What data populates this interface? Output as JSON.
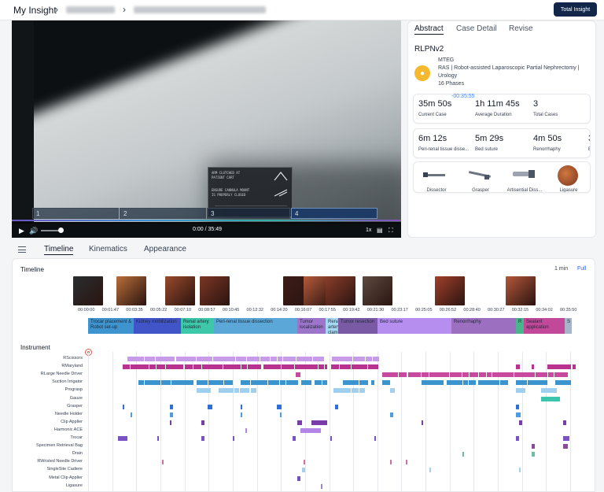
{
  "header": {
    "breadcrumb_root": "My Insight",
    "total_insight_label": "Total Insight"
  },
  "video": {
    "overlay_lines": [
      "ARM CLUTCHED AT",
      "PATIENT CART",
      "ENSURE CANNULA MOUNT",
      "IS PROPERLY CLOSED"
    ],
    "phase_markers": [
      "1",
      "2",
      "3",
      "4"
    ],
    "time": "0:00 / 35:49",
    "speed": "1x"
  },
  "panel": {
    "tabs": [
      "Abstract",
      "Case Detail",
      "Revise"
    ],
    "procedure_title": "RLPNv2",
    "meta": {
      "line1": "MTEG",
      "line2": "RAS | Robot-assisted Laparoscopic Partial Nephrectomy |",
      "line3": "Urology",
      "line4": "16 Phases"
    },
    "stats": [
      {
        "value": "35m 50s",
        "label": "Current Case",
        "overlay": "-00:35:55"
      },
      {
        "value": "1h 11m 45s",
        "label": "Average Duration"
      },
      {
        "value": "3",
        "label": "Total Cases"
      }
    ],
    "phase_stats": [
      {
        "value": "6m 12s",
        "label": "Peri-renal tissue disse..."
      },
      {
        "value": "5m 29s",
        "label": "Bed suture"
      },
      {
        "value": "4m 50s",
        "label": "Renorrhaphy"
      },
      {
        "value": "3",
        "label": "B"
      }
    ],
    "instruments": [
      {
        "label": "Dissector",
        "icon": "dissector-icon"
      },
      {
        "label": "Grasper",
        "icon": "grasper-icon"
      },
      {
        "label": "Artisential Diss...",
        "icon": "artisential-dissector-icon"
      },
      {
        "label": "Ligasure",
        "icon": "ligasure-icon"
      }
    ]
  },
  "tabs": [
    "Timeline",
    "Kinematics",
    "Appearance"
  ],
  "timeline": {
    "title": "Timeline",
    "zoom_options": [
      "1 min",
      "Full"
    ],
    "ticks": [
      "00:00:00",
      "00:01:47",
      "00:03:35",
      "00:05:22",
      "00:07:10",
      "00:08:57",
      "00:10:45",
      "00:12:32",
      "00:14:20",
      "00:16:07",
      "00:17:55",
      "00:19:42",
      "00:21:30",
      "00:23:17",
      "00:25:05",
      "00:26:52",
      "00:28:40",
      "00:30:27",
      "00:32:15",
      "00:34:02",
      "00:35:50"
    ],
    "thumb_colors": [
      "#2a2e30",
      "#b96e3a",
      "#9a4a2c",
      "#7b3624",
      "#3d1c18",
      "#b75a3a",
      "#8a3d2a",
      "#5e4a40",
      "#a0402a",
      "#b4573a"
    ],
    "phases": [
      {
        "label": "Trocar placement & Robot set-up",
        "color": "#3e94cf"
      },
      {
        "label": "Kidney mobilization",
        "color": "#4255c8"
      },
      {
        "label": "Renal artery isolation",
        "color": "#3cc8a9"
      },
      {
        "label": "Peri-renal tissue dissection",
        "color": "#5aa7d8"
      },
      {
        "label": "Tumor localization",
        "color": "#9c74c9"
      },
      {
        "label": "Renal artery clamping",
        "color": "#a7d8f2"
      },
      {
        "label": "Tumor resection",
        "color": "#7a5aa5"
      },
      {
        "label": "Bed suture",
        "color": "#b58ef0"
      },
      {
        "label": "Renorrhaphy",
        "color": "#9d6fc0"
      },
      {
        "label": "R",
        "color": "#4ab48a"
      },
      {
        "label": "Sealant application",
        "color": "#c2489a"
      },
      {
        "label": "S",
        "color": "#aab4c8"
      }
    ]
  },
  "instrument_section": {
    "title": "Instrument",
    "rows": [
      {
        "label": "RScissors",
        "color": "#c79be8"
      },
      {
        "label": "RMaryland",
        "color": "#b8328f"
      },
      {
        "label": "RLarge Needle Driver",
        "color": "#c84a9e"
      },
      {
        "label": "Suction Irrigator",
        "color": "#3c94cf"
      },
      {
        "label": "Prograsp",
        "color": "#9fd0f0"
      },
      {
        "label": "Gauze",
        "color": "#3cc4ac"
      },
      {
        "label": "Grasper",
        "color": "#2f6fd8"
      },
      {
        "label": "Needle Holder",
        "color": "#4c9ee0"
      },
      {
        "label": "Clip Applier",
        "color": "#7a3ca8"
      },
      {
        "label": "Harmonic ACE",
        "color": "#b285e6"
      },
      {
        "label": "Trocar",
        "color": "#7b52c4"
      },
      {
        "label": "Specimen Retrieval Bag",
        "color": "#8a4a9e"
      },
      {
        "label": "Drain",
        "color": "#6bbfa0"
      },
      {
        "label": "RWristed Needle Driver",
        "color": "#d0709e"
      },
      {
        "label": "SingleSite Cadiere",
        "color": "#a8cfe8"
      },
      {
        "label": "Metal Clip Applier",
        "color": "#7a50b8"
      },
      {
        "label": "Ligasure",
        "color": "#9e80d0"
      }
    ]
  }
}
